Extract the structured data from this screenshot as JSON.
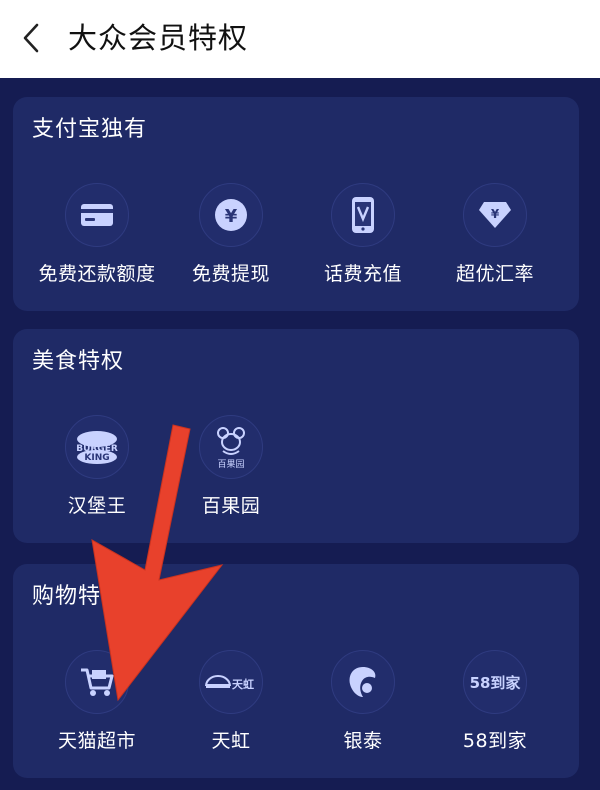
{
  "header": {
    "title": "大众会员特权"
  },
  "sections": [
    {
      "title": "支付宝独有",
      "items": [
        {
          "label": "免费还款额度",
          "icon": "credit-card-icon"
        },
        {
          "label": "免费提现",
          "icon": "yuan-coin-icon"
        },
        {
          "label": "话费充值",
          "icon": "phone-recharge-icon"
        },
        {
          "label": "超优汇率",
          "icon": "diamond-yuan-icon"
        }
      ]
    },
    {
      "title": "美食特权",
      "items": [
        {
          "label": "汉堡王",
          "icon": "burger-king-logo",
          "logo_text": "BURGER KING"
        },
        {
          "label": "百果园",
          "icon": "pagoda-logo",
          "logo_text": "百果园"
        }
      ]
    },
    {
      "title": "购物特权",
      "items": [
        {
          "label": "天猫超市",
          "icon": "tmall-cart-icon"
        },
        {
          "label": "天虹",
          "icon": "rainbow-logo",
          "logo_text": "天虹"
        },
        {
          "label": "银泰",
          "icon": "intime-logo"
        },
        {
          "label": "58到家",
          "icon": "58-daojia-logo",
          "logo_text": "58到家"
        }
      ]
    }
  ],
  "colors": {
    "background": "#151c52",
    "card": "#1f2a66",
    "icon_accent": "#c9d2ff",
    "arrow": "#e8412c"
  }
}
